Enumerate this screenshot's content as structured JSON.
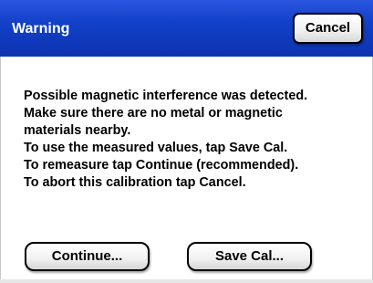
{
  "dialog": {
    "title": "Warning",
    "cancel_label": "Cancel",
    "message_lines": [
      "Possible magnetic interference was detected.",
      "Make sure there are no metal or magnetic",
      "materials nearby.",
      "To use the measured values, tap Save Cal.",
      "To remeasure tap Continue (recommended).",
      "To abort this calibration tap Cancel."
    ],
    "continue_label": "Continue...",
    "save_cal_label": "Save Cal..."
  },
  "colors": {
    "title_bar": "#1240c8",
    "title_text": "#ffffff",
    "background": "#ffffff",
    "button_border": "#000000"
  }
}
